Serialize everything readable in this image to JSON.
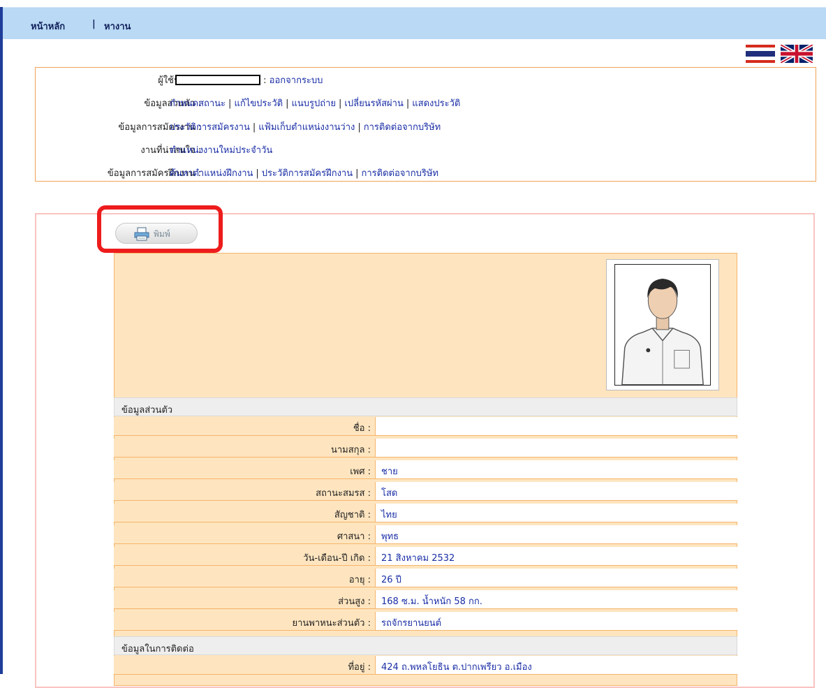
{
  "nav": {
    "home": "หน้าหลัก",
    "separator": "|",
    "jobs": "หางาน"
  },
  "user_box": {
    "user_label": "ผู้ใช้ระบบ :",
    "logout_prefix": ":",
    "logout": "ออกจากระบบ",
    "personal_label": "ข้อมูลส่วนตัว :",
    "personal_links": [
      "กำหนดสถานะ",
      "แก้ไขประวัติ",
      "แนบรูปถ่าย",
      "เปลี่ยนรหัสผ่าน",
      "แสดงประวัติ"
    ],
    "application_label": "ข้อมูลการสมัครงาน :",
    "application_links": [
      "ประวัติการสมัครงาน",
      "แฟ้มเก็บตำแหน่งงานว่าง",
      "การติดต่อจากบริษัท"
    ],
    "interest_label": "งานที่น่าสนใจ :",
    "interest_links": [
      "ตำแหน่งงานใหม่ประจำวัน"
    ],
    "internship_label": "ข้อมูลการสมัครฝึกงาน :",
    "internship_links": [
      "ค้นหาตำแหน่งฝึกงาน",
      "ประวัติการสมัครฝึกงาน",
      "การติดต่อจากบริษัท"
    ]
  },
  "print_button": {
    "label": "พิมพ์",
    "icon": "printer-icon"
  },
  "colors": {
    "nav_bg": "#b9d9f5",
    "box_border": "#f0a35a",
    "panel_bg": "#fee5bf",
    "link": "#1a2ea6",
    "highlight": "#ee1c1c"
  },
  "profile": {
    "personal_header": "ข้อมูลส่วนตัว",
    "fields": [
      {
        "label": "ชื่อ :",
        "value": ""
      },
      {
        "label": "นามสกุล :",
        "value": ""
      },
      {
        "label": "เพศ :",
        "value": "ชาย"
      },
      {
        "label": "สถานะสมรส :",
        "value": " โสด"
      },
      {
        "label": "สัญชาติ :",
        "value": "ไทย"
      },
      {
        "label": "ศาสนา :",
        "value": "พุทธ"
      },
      {
        "label": "วัน-เดือน-ปี เกิด :",
        "value": "21 สิงหาคม 2532"
      },
      {
        "label": "อายุ :",
        "value": "26 ปี"
      },
      {
        "label": "ส่วนสูง :",
        "value": "168 ซ.ม.  น้ำหนัก 58 กก."
      },
      {
        "label": "ยานพาหนะส่วนตัว :",
        "value": "รถจักรยานยนต์"
      }
    ],
    "contact_header": "ข้อมูลในการติดต่อ",
    "contact_fields": [
      {
        "label": "ที่อยู่ :",
        "value": "424 ถ.พหลโยธิน ต.ปากเพรียว อ.เมือง"
      }
    ]
  }
}
